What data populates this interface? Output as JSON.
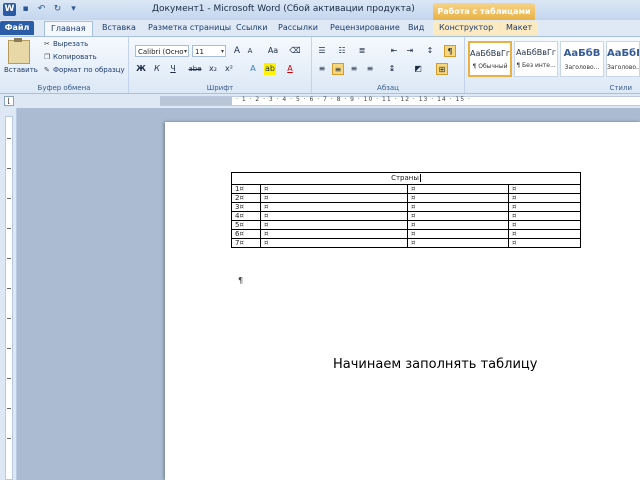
{
  "window": {
    "title": "Документ1 - Microsoft Word (Сбой активации продукта)",
    "context_group": "Работа с таблицами"
  },
  "qat": {
    "word_icon": "word-logo-icon",
    "save_icon": "save-icon",
    "undo_icon": "undo-icon",
    "redo_icon": "redo-icon"
  },
  "tabs": {
    "file": "Файл",
    "home": "Главная",
    "insert": "Вставка",
    "layout": "Разметка страницы",
    "refs": "Ссылки",
    "mailings": "Рассылки",
    "review": "Рецензирование",
    "view": "Вид",
    "design": "Конструктор",
    "table_layout": "Макет"
  },
  "clipboard": {
    "paste": "Вставить",
    "cut": "Вырезать",
    "copy": "Копировать",
    "format_painter": "Формат по образцу",
    "label": "Буфер обмена"
  },
  "font": {
    "name": "Calibri (Осно",
    "size": "11",
    "label": "Шрифт",
    "bold": "Ж",
    "italic": "К",
    "underline": "Ч",
    "strike": "abe",
    "sub": "x₂",
    "sup": "x²",
    "grow": "A",
    "shrink": "A",
    "change_case": "Aa"
  },
  "paragraph": {
    "label": "Абзац",
    "pilcrow": "¶"
  },
  "styles": {
    "label": "Стили",
    "items": [
      {
        "sample": "АаБбВвГг",
        "name": "¶ Обычный"
      },
      {
        "sample": "АаБбВвГг",
        "name": "¶ Без инте..."
      },
      {
        "sample": "АаБбВ",
        "name": "Заголово..."
      },
      {
        "sample": "АаБбВ",
        "name": "Заголово..."
      }
    ]
  },
  "document": {
    "table": {
      "header": "Страны",
      "rows": [
        {
          "col1": "1",
          "col2": "",
          "col3": "",
          "col4": ""
        },
        {
          "col1": "2",
          "col2": "",
          "col3": "",
          "col4": ""
        },
        {
          "col1": "3",
          "col2": "",
          "col3": "",
          "col4": ""
        },
        {
          "col1": "4",
          "col2": "",
          "col3": "",
          "col4": ""
        },
        {
          "col1": "5",
          "col2": "",
          "col3": "",
          "col4": ""
        },
        {
          "col1": "6",
          "col2": "",
          "col3": "",
          "col4": ""
        },
        {
          "col1": "7",
          "col2": "",
          "col3": "",
          "col4": ""
        }
      ]
    },
    "caption": "Начинаем заполнять таблицу"
  },
  "colors": {
    "file_tab": "#2a5ca8",
    "context_group": "#e9b143",
    "workspace": "#abbbd1"
  }
}
